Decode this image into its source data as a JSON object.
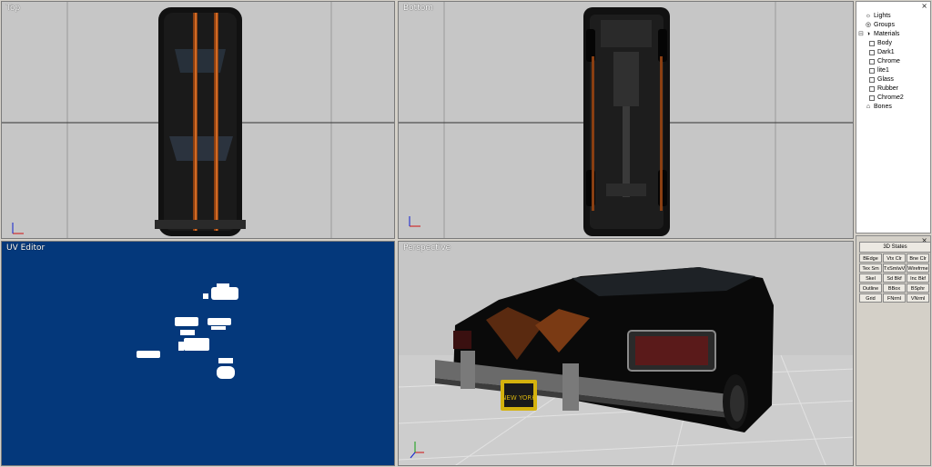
{
  "viewports": {
    "top": {
      "label": "Top",
      "axis_h": "x",
      "axis_v": "y"
    },
    "bottom": {
      "label": "Bottom",
      "axis_h": "x",
      "axis_v": "z"
    },
    "uv": {
      "label": "UV Editor"
    },
    "perspective": {
      "label": "Perspective",
      "plate_text": "NEW YORK"
    }
  },
  "scene_tree": {
    "close": "×",
    "items": [
      {
        "label": "Lights",
        "icon": "lights-icon"
      },
      {
        "label": "Groups",
        "icon": "groups-icon"
      },
      {
        "label": "Materials",
        "icon": "materials-icon"
      },
      {
        "label": "Body",
        "icon": "material-icon"
      },
      {
        "label": "Dark1",
        "icon": "material-icon"
      },
      {
        "label": "Chrome",
        "icon": "material-icon"
      },
      {
        "label": "lite1",
        "icon": "material-icon"
      },
      {
        "label": "Glass",
        "icon": "material-icon"
      },
      {
        "label": "Rubber",
        "icon": "material-icon"
      },
      {
        "label": "Chrome2",
        "icon": "material-icon"
      },
      {
        "label": "Bones",
        "icon": "bones-icon"
      }
    ]
  },
  "states_panel": {
    "close": "×",
    "title_button": "3D States",
    "buttons": [
      "BEdge",
      "Vtx Clr",
      "Bne Clr",
      "Tex Sm",
      "TxSmlwV",
      "Wirefrme",
      "Skel",
      "Sd Bkf",
      "Inc Bkf",
      "Outline",
      "BBox",
      "BSphr",
      "Grid",
      "FNrml",
      "VNrml"
    ]
  },
  "colors": {
    "viewport_bg": "#c6c6c6",
    "uv_bg": "#04387b",
    "accent_stripe": "#c8641e"
  }
}
